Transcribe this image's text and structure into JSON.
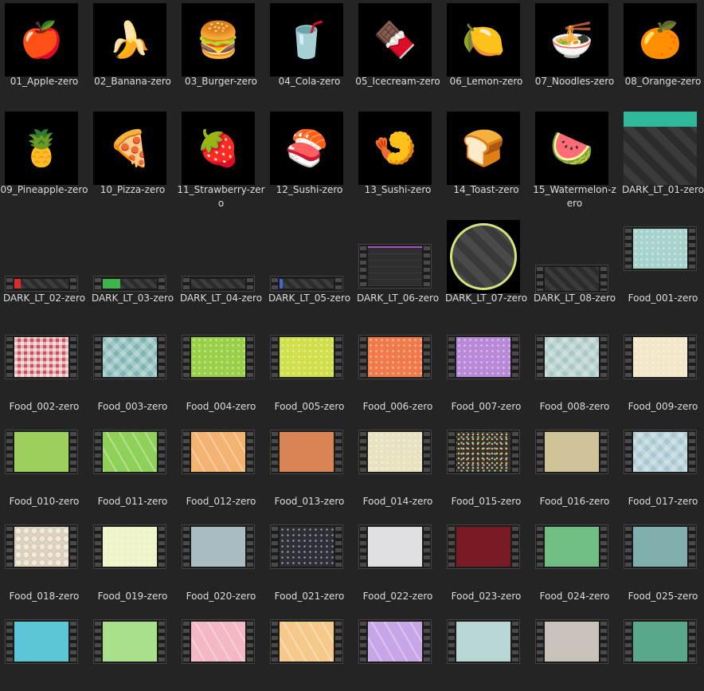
{
  "items": [
    {
      "label": "01_Apple-zero",
      "kind": "icon",
      "glyph": "🍎",
      "icon": "apple-icon"
    },
    {
      "label": "02_Banana-zero",
      "kind": "icon",
      "glyph": "🍌",
      "icon": "banana-icon"
    },
    {
      "label": "03_Burger-zero",
      "kind": "icon",
      "glyph": "🍔",
      "icon": "burger-icon"
    },
    {
      "label": "04_Cola-zero",
      "kind": "icon",
      "glyph": "🥤",
      "icon": "cola-icon"
    },
    {
      "label": "05_Icecream-zero",
      "kind": "icon",
      "glyph": "🍫",
      "icon": "icecream-icon"
    },
    {
      "label": "06_Lemon-zero",
      "kind": "icon",
      "glyph": "🍋",
      "icon": "lemon-icon"
    },
    {
      "label": "07_Noodles-zero",
      "kind": "icon",
      "glyph": "🍜",
      "icon": "noodles-icon"
    },
    {
      "label": "08_Orange-zero",
      "kind": "icon",
      "glyph": "🍊",
      "icon": "orange-icon"
    },
    {
      "label": "09_Pineapple-zero",
      "kind": "icon",
      "glyph": "🍍",
      "icon": "pineapple-icon"
    },
    {
      "label": "10_Pizza-zero",
      "kind": "icon",
      "glyph": "🍕",
      "icon": "pizza-icon"
    },
    {
      "label": "11_Strawberry-zero",
      "kind": "icon",
      "glyph": "🍓",
      "icon": "strawberry-icon"
    },
    {
      "label": "12_Sushi-zero",
      "kind": "icon",
      "glyph": "🍣",
      "icon": "sushi-icon"
    },
    {
      "label": "13_Sushi-zero",
      "kind": "icon",
      "glyph": "🍤",
      "icon": "sushi-shrimp-icon"
    },
    {
      "label": "14_Toast-zero",
      "kind": "icon",
      "glyph": "🍞",
      "icon": "toast-icon"
    },
    {
      "label": "15_Watermelon-zero",
      "kind": "icon",
      "glyph": "🍉",
      "icon": "watermelon-icon"
    },
    {
      "label": "DARK_LT_01-zero",
      "kind": "dark01",
      "accent": "#2fb99a"
    },
    {
      "label": "DARK_LT_02-zero",
      "kind": "bar",
      "accent": "#d92d2d",
      "fill": 0.12
    },
    {
      "label": "DARK_LT_03-zero",
      "kind": "bar",
      "accent": "#3cb54a",
      "fill": 0.32
    },
    {
      "label": "DARK_LT_04-zero",
      "kind": "bar",
      "accent": "#3a3a3a",
      "fill": 0.0
    },
    {
      "label": "DARK_LT_05-zero",
      "kind": "bar",
      "accent": "#3f67d6",
      "fill": 0.06
    },
    {
      "label": "DARK_LT_06-zero",
      "kind": "dark06",
      "accent": "#b04fc8"
    },
    {
      "label": "DARK_LT_07-zero",
      "kind": "dark07",
      "accent": "#d7e27a"
    },
    {
      "label": "DARK_LT_08-zero",
      "kind": "dark08"
    },
    {
      "label": "Food_001-zero",
      "kind": "food",
      "color": "#a7d3cc",
      "pattern": "dots"
    },
    {
      "label": "Food_002-zero",
      "kind": "food",
      "color": "#c9555a",
      "pattern": "gingham"
    },
    {
      "label": "Food_003-zero",
      "kind": "food",
      "color": "#7fb4b2",
      "pattern": "plaid"
    },
    {
      "label": "Food_004-zero",
      "kind": "food",
      "color": "#99d048",
      "pattern": "dots"
    },
    {
      "label": "Food_005-zero",
      "kind": "food",
      "color": "#cfe04a",
      "pattern": "dots"
    },
    {
      "label": "Food_006-zero",
      "kind": "food",
      "color": "#f07a4a",
      "pattern": "dots"
    },
    {
      "label": "Food_007-zero",
      "kind": "food",
      "color": "#b889d9",
      "pattern": "dots"
    },
    {
      "label": "Food_008-zero",
      "kind": "food",
      "color": "#a9c8c3",
      "pattern": "plaid"
    },
    {
      "label": "Food_009-zero",
      "kind": "food",
      "color": "#f3e6c9",
      "pattern": "dots"
    },
    {
      "label": "Food_010-zero",
      "kind": "food",
      "color": "#9ccf5c",
      "pattern": "plain"
    },
    {
      "label": "Food_011-zero",
      "kind": "food",
      "color": "#8fd058",
      "pattern": "diag"
    },
    {
      "label": "Food_012-zero",
      "kind": "food",
      "color": "#f2b470",
      "pattern": "diag"
    },
    {
      "label": "Food_013-zero",
      "kind": "food",
      "color": "#d98452",
      "pattern": "plain"
    },
    {
      "label": "Food_014-zero",
      "kind": "food",
      "color": "#e8e2c0",
      "pattern": "dots"
    },
    {
      "label": "Food_015-zero",
      "kind": "food",
      "color": "#3a2f2f",
      "pattern": "sprinkles"
    },
    {
      "label": "Food_016-zero",
      "kind": "food",
      "color": "#cfc497",
      "pattern": "plain"
    },
    {
      "label": "Food_017-zero",
      "kind": "food",
      "color": "#a9c7d1",
      "pattern": "plaid"
    },
    {
      "label": "Food_018-zero",
      "kind": "food",
      "color": "#e0d4bd",
      "pattern": "hex"
    },
    {
      "label": "Food_019-zero",
      "kind": "food",
      "color": "#eef3c8",
      "pattern": "dots"
    },
    {
      "label": "Food_020-zero",
      "kind": "food",
      "color": "#a9bdc0",
      "pattern": "plain"
    },
    {
      "label": "Food_021-zero",
      "kind": "food",
      "color": "#2d2f38",
      "pattern": "dots"
    },
    {
      "label": "Food_022-zero",
      "kind": "food",
      "color": "#e0dfe4",
      "pattern": "plain"
    },
    {
      "label": "Food_023-zero",
      "kind": "food",
      "color": "#7a1a24",
      "pattern": "plain"
    },
    {
      "label": "Food_024-zero",
      "kind": "food",
      "color": "#6fbf85",
      "pattern": "plain"
    },
    {
      "label": "Food_025-zero",
      "kind": "food",
      "color": "#80b0ad",
      "pattern": "plain"
    },
    {
      "label": "",
      "kind": "food",
      "color": "#5cc6d6",
      "pattern": "plain"
    },
    {
      "label": "",
      "kind": "food",
      "color": "#a8e08c",
      "pattern": "plain"
    },
    {
      "label": "",
      "kind": "food",
      "color": "#f3b8c4",
      "pattern": "diag"
    },
    {
      "label": "",
      "kind": "food",
      "color": "#f4c98a",
      "pattern": "diag"
    },
    {
      "label": "",
      "kind": "food",
      "color": "#c6a6e6",
      "pattern": "diag"
    },
    {
      "label": "",
      "kind": "food",
      "color": "#b8d6d4",
      "pattern": "plain"
    },
    {
      "label": "",
      "kind": "food",
      "color": "#c8c2ba",
      "pattern": "plain"
    },
    {
      "label": "",
      "kind": "food",
      "color": "#5aa88a",
      "pattern": "plain"
    }
  ]
}
